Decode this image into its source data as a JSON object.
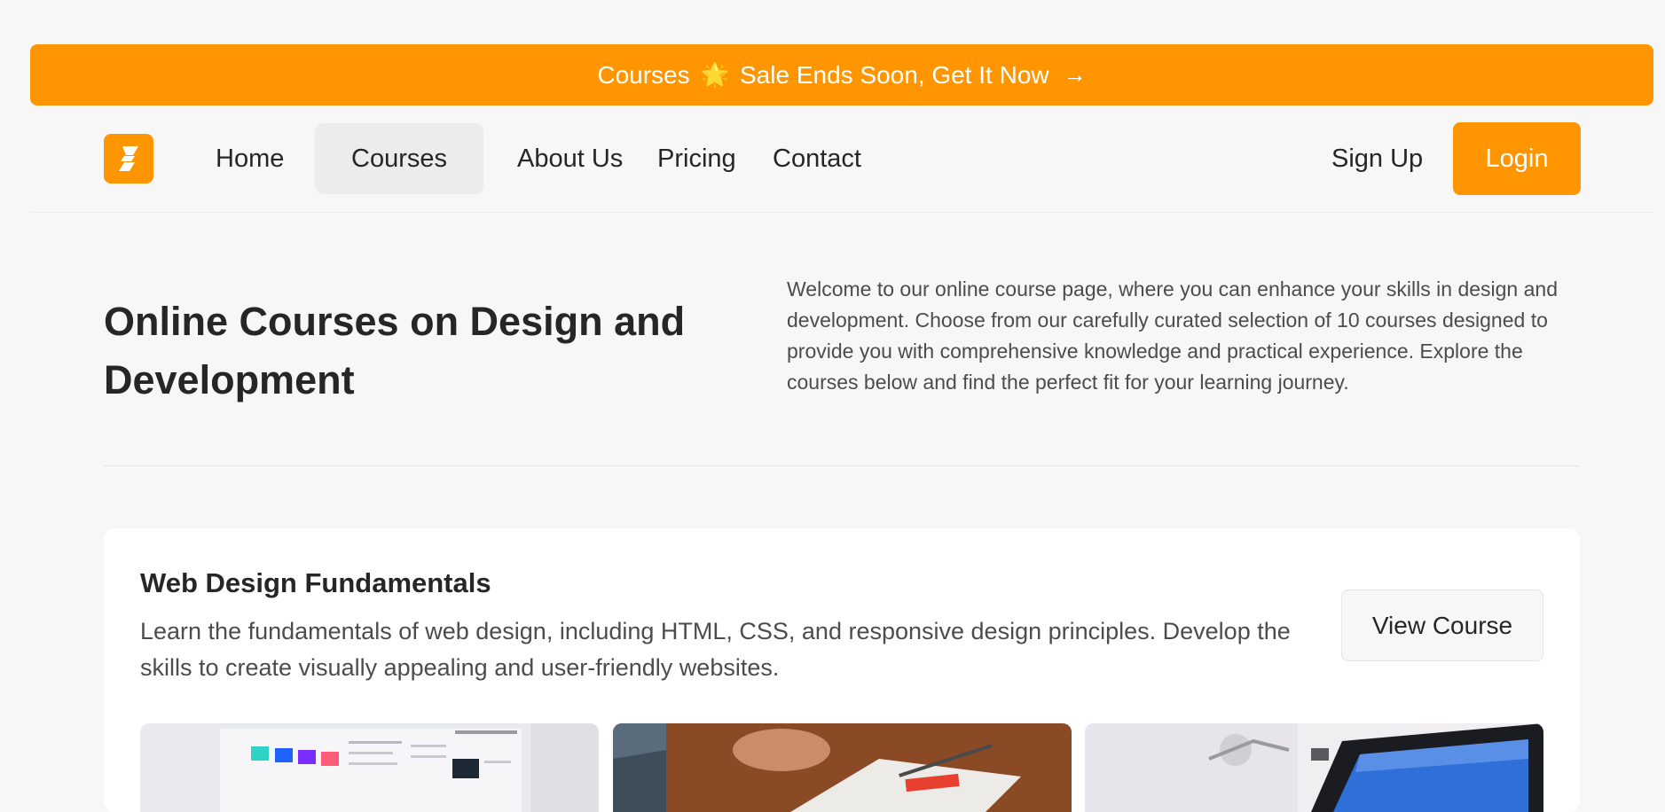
{
  "banner": {
    "text_before": "Courses",
    "emoji": "🌟",
    "text_after": "Sale Ends Soon, Get It Now",
    "arrow": "→"
  },
  "nav": {
    "logo_icon": "skillbridge-logo-icon",
    "links": [
      {
        "label": "Home"
      },
      {
        "label": "Courses",
        "active": true
      },
      {
        "label": "About Us"
      },
      {
        "label": "Pricing"
      },
      {
        "label": "Contact"
      }
    ],
    "signup_label": "Sign Up",
    "login_label": "Login"
  },
  "hero": {
    "title": "Online Courses on Design and Development",
    "description": "Welcome to our online course page, where you can enhance your skills in design and development. Choose from our carefully curated selection of 10 courses designed to provide you with comprehensive knowledge and practical experience. Explore the courses below and find the perfect fit for your learning journey."
  },
  "course": {
    "title": "Web Design Fundamentals",
    "description": "Learn the fundamentals of web design, including HTML, CSS, and responsive design principles. Develop the skills to create visually appealing and user-friendly websites.",
    "view_label": "View Course"
  },
  "colors": {
    "accent": "#ff9500",
    "background": "#f7f7f7",
    "text": "#262626",
    "muted_text": "#4c4c4d"
  }
}
